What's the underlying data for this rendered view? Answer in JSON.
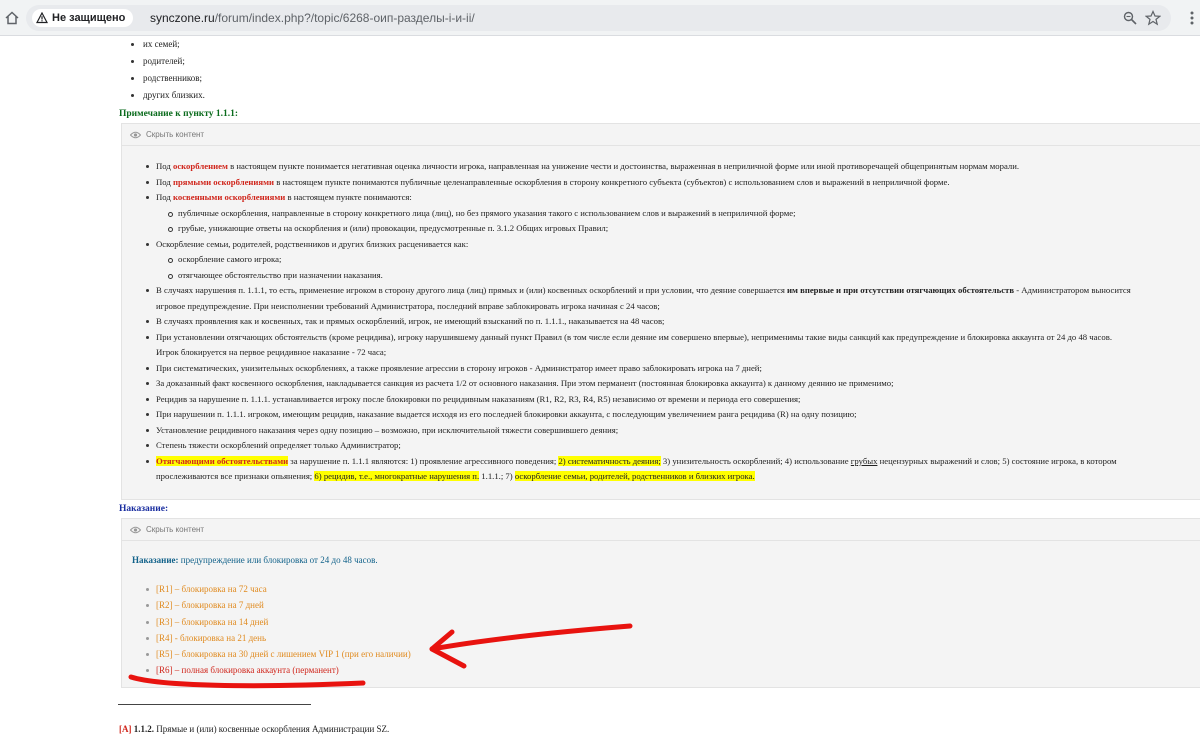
{
  "browser": {
    "security_label": "Не защищено",
    "url_host": "synczone.ru",
    "url_path": "/forum/index.php?/topic/6268-оип-разделы-i-и-ii/",
    "icons": [
      "home-icon",
      "warning-icon",
      "zoom-icon",
      "star-icon",
      "menu-icon"
    ]
  },
  "top_list": [
    "их семей;",
    "родителей;",
    "родственников;",
    "других близких."
  ],
  "note_heading": "Примечание к пункту 1.1.1:",
  "spoiler_label": "Скрыть контент",
  "notes": {
    "n1a": "Под ",
    "n1b": "оскорблением",
    "n1c": " в настоящем пункте понимается негативная оценка личности игрока, направленная на унижение чести и достоинства, выраженная в неприличной форме или иной противоречащей общепринятым нормам морали.",
    "n2a": "Под ",
    "n2b": "прямыми оскорблениями",
    "n2c": " в настоящем пункте понимаются публичные целенаправленные оскорбления в сторону конкретного субъекта (субъектов) с использованием слов и выражений в неприличной форме.",
    "n3a": "Под ",
    "n3b": "косвенными оскорблениями",
    "n3c": " в настоящем пункте понимаются:",
    "s1": "публичные оскорбления, направленные в сторону конкретного лица (лиц), но без прямого указания такого с использованием слов и выражений в неприличной форме;",
    "s2": "грубые, унижающие ответы на оскорбления и (или) провокации, предусмотренные п. 3.1.2 Общих игровых Правил;",
    "n4": "Оскорбление семьи, родителей, родственников и других близких расценивается как:",
    "s3": "оскорбление самого игрока;",
    "s4": "отягчающее обстоятельство при назначении наказания.",
    "n5a": "В случаях нарушения п. 1.1.1, то есть, применение игроком в сторону другого лица (лиц) прямых и (или) косвенных оскорблений и при условии, что деяние совершается ",
    "n5b": "им впервые и при отсутствии отягчающих обстоятельств",
    "n5c": " - Администратором выносится",
    "n5d": "игровое предупреждение. При неисполнении требований Администратора, последний вправе заблокировать игрока начиная с 24 часов;",
    "n6": "В случаях проявления как и косвенных, так и прямых оскорблений, игрок, не имеющий взысканий по п. 1.1.1., наказывается на 48 часов;",
    "n7a": "При установлении отягчающих обстоятельств (кроме рецидива), игроку нарушившему данный пункт Правил (в том числе если деяние им совершено впервые), неприменимы такие виды санкций как предупреждение и блокировка аккаунта от 24 до 48 часов.",
    "n7b": "Игрок блокируется на первое рецидивное наказание - 72 часа;",
    "n8": "При систематических, унизительных оскорблениях, а также проявление агрессии в сторону игроков - Администратор имеет право заблокировать игрока на 7 дней;",
    "n9": "За доказанный факт косвенного оскорбления, накладывается санкция из расчета 1/2 от основного наказания. При этом перманент (постоянная блокировка аккаунта) к данному деянию не применимо;",
    "n10": "Рецидив за нарушение п. 1.1.1. устанавливается игроку после блокировки по рецидивным наказаниям (R1, R2, R3, R4, R5) независимо от времени и периода его совершения;",
    "n11": "При нарушении п. 1.1.1. игроком, имеющим рецидив, наказание выдается исходя из его последней блокировки аккаунта, с последующим увеличением ранга рецидива (R) на одну позицию;",
    "n12": "Установление рецидивного наказания через одну позицию – возможно, при исключительной тяжести совершившего деяния;",
    "n13": "Степень тяжести оскорблений определяет только Администратор;",
    "n14a": "Отягчающими обстоятельствами",
    "n14b": " за нарушение п. 1.1.1 являются: 1) проявление агрессивного поведения; ",
    "n14c": "2) систематичность деяния;",
    "n14d": " 3) унизительность оскорблений; 4) использование ",
    "n14e": "грубых",
    "n14f": " нецензурных выражений и слов; 5) состояние игрока, в котором",
    "n14g": "прослеживаются все признаки опьянения; ",
    "n14h": "6) рецидив, т.е., многократные нарушения п.",
    "n14i": " 1.1.1.; 7) ",
    "n14j": "оскорбление семьи, родителей, родственников и близких игрока."
  },
  "punish_heading": "Наказание:",
  "punish": {
    "label": "Наказание:",
    "text": " предупреждение или блокировка от 24 до 48 часов.",
    "ranks": [
      "[R1] – блокировка на 72 часа",
      "[R2] – блокировка на 7 дней",
      "[R3] – блокировка на 14 дней",
      "[R4] - блокировка на 21 день",
      "[R5] – блокировка на 30 дней с лишением VIP 1 (при его наличии)",
      "[R6] – полная блокировка аккаунта (перманент)"
    ]
  },
  "footnote": {
    "tag": "[A]",
    "num": "1.1.2.",
    "text": " Прямые и (или) косвенные оскорбления Администрации SZ."
  },
  "colors": {
    "annotation": "#e8130f",
    "highlight": "#ffff00",
    "warning": "#d0261c",
    "rank": "#e08a1e"
  }
}
